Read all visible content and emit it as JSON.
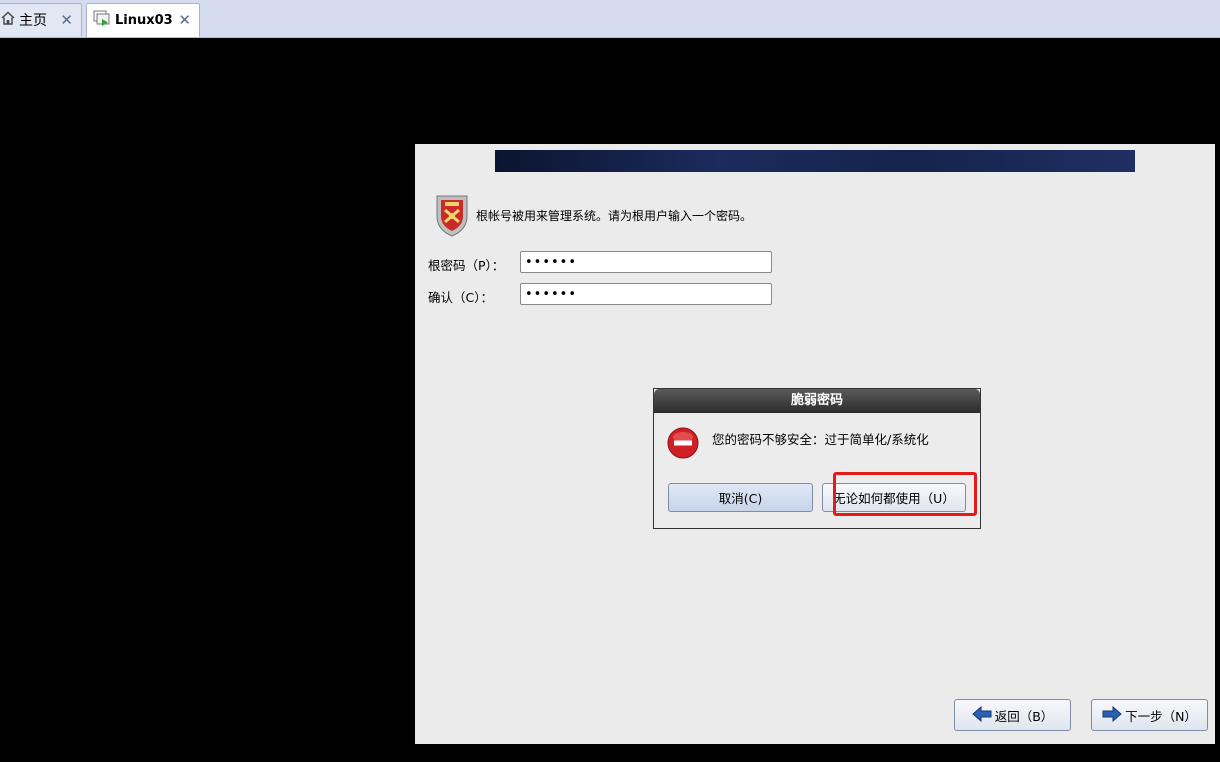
{
  "tabs": [
    {
      "label": "主页",
      "icon": "home-icon",
      "close": "✕"
    },
    {
      "label": "Linux03",
      "icon": "vm-icon",
      "close": "✕"
    }
  ],
  "installer": {
    "description": "根帐号被用来管理系统。请为根用户输入一个密码。",
    "root_password_label": "根密码（P）：",
    "root_password_value": "••••••",
    "confirm_label": "确认（C）：",
    "confirm_value": "••••••",
    "back_label": "返回（B）",
    "next_label": "下一步（N）"
  },
  "dialog": {
    "title": "脆弱密码",
    "message": "您的密码不够安全：过于简单化/系统化",
    "cancel_label": "取消(C)",
    "use_anyway_label": "无论如何都使用（U）"
  },
  "colors": {
    "highlight": "#e31b1b",
    "banner": "#14244c",
    "error": "#d11f26"
  }
}
